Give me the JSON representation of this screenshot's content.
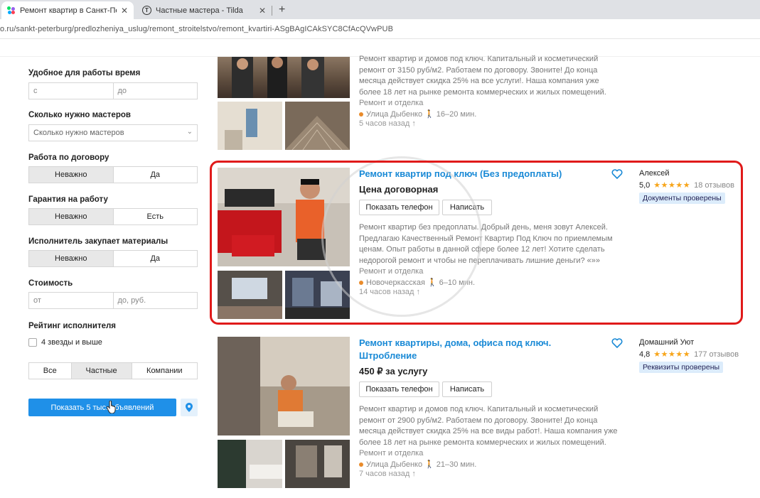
{
  "browser": {
    "tabs": [
      {
        "title": "Ремонт квартир в Санкт-Петерб",
        "active": true
      },
      {
        "title": "Частные мастера - Tilda",
        "active": false
      }
    ],
    "new_tab": "+",
    "close": "✕",
    "url": "o.ru/sankt-peterburg/predlozheniya_uslug/remont_stroitelstvo/remont_kvartiri-ASgBAgICAkSYC8CfAcQVwPUB"
  },
  "filters": {
    "time": {
      "label": "Удобное для работы время",
      "from": "с",
      "to": "до"
    },
    "masters": {
      "label": "Сколько нужно мастеров",
      "placeholder": "Сколько нужно мастеров"
    },
    "contract": {
      "label": "Работа по договору",
      "options": [
        "Неважно",
        "Да"
      ]
    },
    "warranty": {
      "label": "Гарантия на работу",
      "options": [
        "Неважно",
        "Есть"
      ]
    },
    "materials": {
      "label": "Исполнитель закупает материалы",
      "options": [
        "Неважно",
        "Да"
      ]
    },
    "price": {
      "label": "Стоимость",
      "from": "от",
      "to": "до, руб."
    },
    "rating": {
      "label": "Рейтинг исполнителя",
      "checkbox": "4 звезды и выше"
    },
    "seller_type": {
      "options": [
        "Все",
        "Частные",
        "Компании"
      ]
    },
    "show_button": "Показать 5 тыс. объявлений"
  },
  "listings": [
    {
      "desc_lines": [
        "Ремонт квартир и домов под ключ. Капитальный и косметический",
        "ремонт от 3150 руб/м2. Работаем по договору. Звоните! До конца",
        "месяца действует скидка 25% на все услуги!. Наша компания уже",
        "более 18 лет на рынке ремонта коммерческих и жилых помещений."
      ],
      "category": "Ремонт и отделка",
      "metro": "Улица Дыбенко",
      "walk": "16–20 мин.",
      "time": "5 часов назад"
    },
    {
      "title": "Ремонт квартир под ключ (Без предоплаты)",
      "price": "Цена договорная",
      "btn_phone": "Показать телефон",
      "btn_write": "Написать",
      "desc_lines": [
        "Ремонт квартир без предоплаты. Добрый день, меня зовут Алексей.",
        "Предлагаю Качественный Ремонт Квартир Под Ключ по приемлемым",
        "ценам. Опыт работы в данной сфере более 12 лет! Хотите сделать",
        "недорогой ремонт и чтобы не переплачивать лишние деньги? «»»"
      ],
      "category": "Ремонт и отделка",
      "metro": "Новочеркасская",
      "walk": "6–10 мин.",
      "time": "14 часов назад",
      "seller": "Алексей",
      "rating": "5,0",
      "stars": "★★★★★",
      "reviews": "18 отзывов",
      "badge": "Документы проверены"
    },
    {
      "title_lines": [
        "Ремонт квартиры, дома, офиса под ключ.",
        "Штробление"
      ],
      "price": "450 ₽ за услугу",
      "btn_phone": "Показать телефон",
      "btn_write": "Написать",
      "desc_lines": [
        "Ремонт квартир и домов под ключ. Капитальный и косметический",
        "ремонт от 2900 руб/м2. Работаем по договору. Звоните! До конца",
        "месяца действует скидка 25% на все виды работ!. Наша компания уже",
        "более 18 лет на рынке ремонта коммерческих и жилых помещений."
      ],
      "category": "Ремонт и отделка",
      "metro": "Улица Дыбенко",
      "walk": "21–30 мин.",
      "time": "7 часов назад",
      "seller": "Домашний Уют",
      "rating": "4,8",
      "stars": "★★★★★",
      "reviews": "177 отзывов",
      "badge": "Реквизиты проверены"
    }
  ],
  "colors": {
    "link": "#1a8ad6",
    "primary": "#1f90e8",
    "highlight": "#e01a1a",
    "star": "#f7a51a"
  }
}
